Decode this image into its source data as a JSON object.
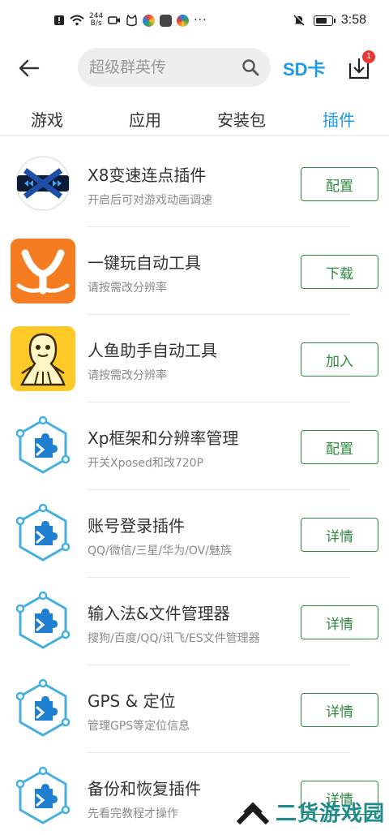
{
  "status_bar": {
    "net_speed_value": "244",
    "net_speed_unit": "B/s",
    "overflow": "···",
    "time": "3:58"
  },
  "header": {
    "search_placeholder": "超级群英传",
    "sd_label": "SD卡",
    "download_badge": "1"
  },
  "tabs": [
    {
      "label": "游戏",
      "active": false
    },
    {
      "label": "应用",
      "active": false
    },
    {
      "label": "安装包",
      "active": false
    },
    {
      "label": "插件",
      "active": true
    }
  ],
  "items": [
    {
      "title": "X8变速连点插件",
      "subtitle": "开启后可对游戏动画调速",
      "button": "配置",
      "icon": "x8-speed-icon"
    },
    {
      "title": "一键玩自动工具",
      "subtitle": "请按需改分辨率",
      "button": "下载",
      "icon": "yijianwan-icon"
    },
    {
      "title": "人鱼助手自动工具",
      "subtitle": "请按需改分辨率",
      "button": "加入",
      "icon": "mermaid-helper-icon"
    },
    {
      "title": "Xp框架和分辨率管理",
      "subtitle": "开关Xposed和改720P",
      "button": "配置",
      "icon": "plugin-puzzle-icon"
    },
    {
      "title": "账号登录插件",
      "subtitle": "QQ/微信/三星/华为/OV/魅族",
      "button": "详情",
      "icon": "plugin-puzzle-icon"
    },
    {
      "title": "输入法&文件管理器",
      "subtitle": "搜狗/百度/QQ/讯飞/ES文件管理器",
      "button": "详情",
      "icon": "plugin-puzzle-icon"
    },
    {
      "title": "GPS & 定位",
      "subtitle": "管理GPS等定位信息",
      "button": "详情",
      "icon": "plugin-puzzle-icon"
    },
    {
      "title": "备份和恢复插件",
      "subtitle": "先看完教程才操作",
      "button": "详情",
      "icon": "plugin-puzzle-icon"
    }
  ],
  "watermark": {
    "text": "二货游戏园"
  },
  "colors": {
    "accent": "#1b9be4",
    "button_green": "#2e8b3e",
    "badge_red": "#e53935"
  }
}
